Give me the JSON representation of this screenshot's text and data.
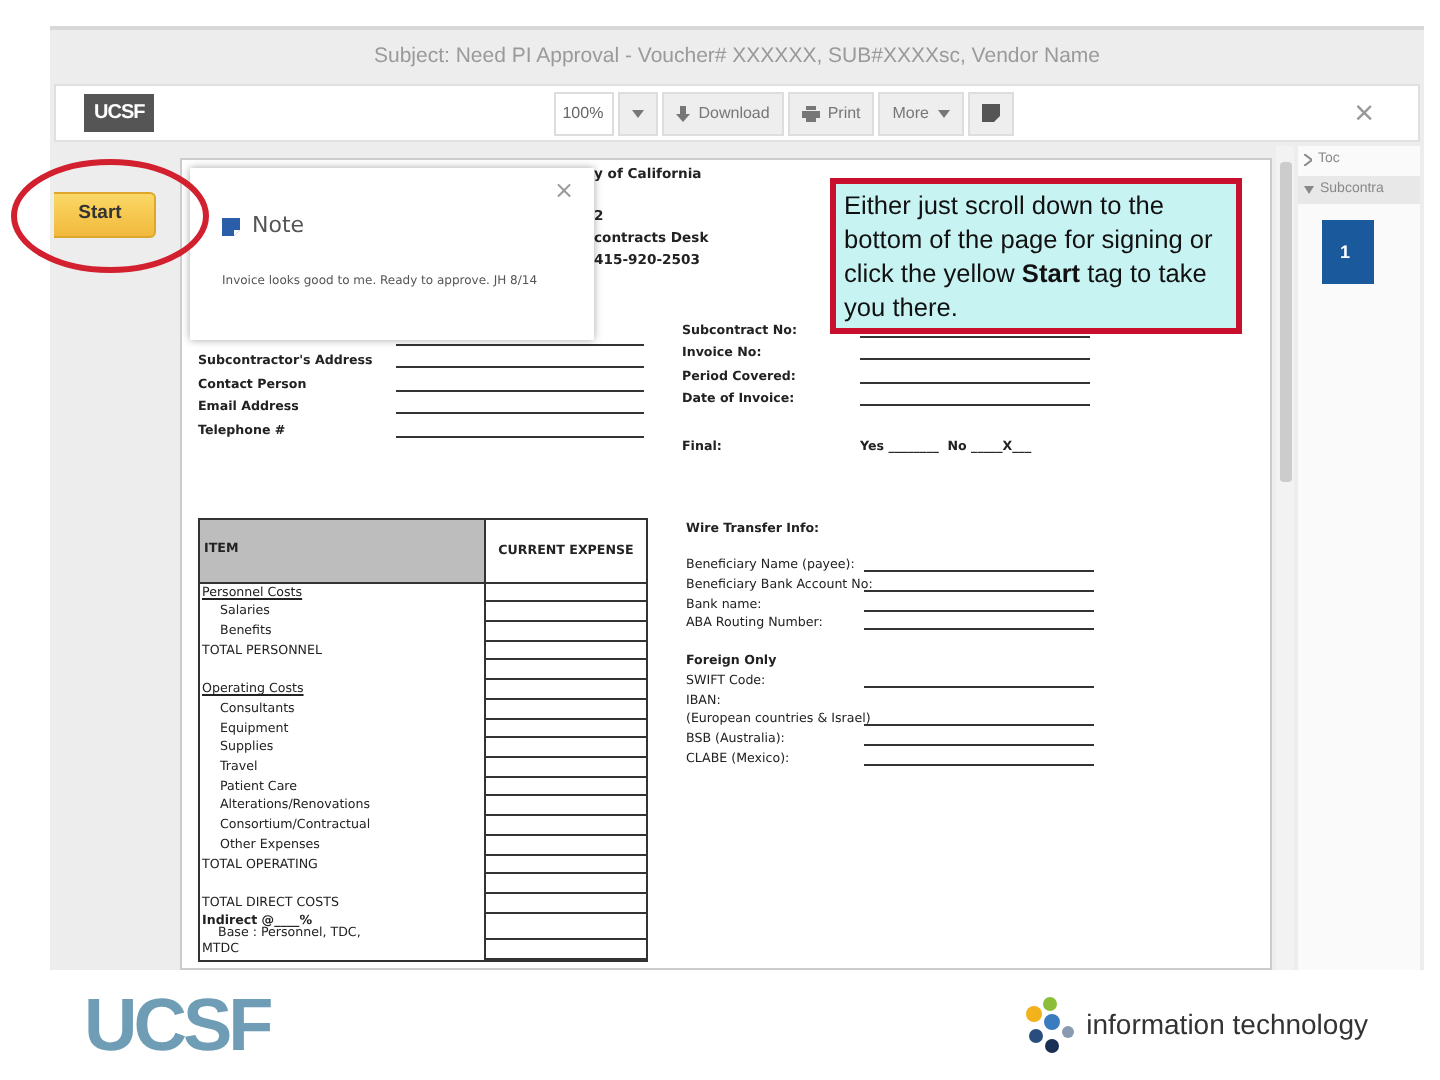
{
  "subject": "Subject: Need PI Approval - Voucher# XXXXXX, SUB#XXXXsc, Vendor Name",
  "toolbar": {
    "logo": "UCSF",
    "zoom": "100%",
    "buttons": [
      {
        "kind": "dropdown"
      },
      {
        "kind": "download",
        "label": "Download"
      },
      {
        "kind": "print",
        "label": "Print"
      },
      {
        "kind": "more",
        "label": "More"
      },
      {
        "kind": "note"
      }
    ],
    "close": "×"
  },
  "start_tag": "Start",
  "note": {
    "title": "Note",
    "text": "Invoice looks good to me. Ready to approve. JH 8/14",
    "close": "×"
  },
  "document": {
    "header_lines": [
      "y of California",
      "2",
      "contracts Desk",
      "415-920-2503"
    ],
    "left_fields": [
      "Subcontractor's Address",
      "Contact Person",
      "Email Address",
      "Telephone #"
    ],
    "right_fields": [
      "Subcontract No:",
      "Invoice No:",
      "Period Covered:",
      "Date of Invoice:"
    ],
    "final": {
      "label": "Final:",
      "value": "Yes ________  No _____X___"
    },
    "table": {
      "columns": [
        "ITEM",
        "CURRENT EXPENSE"
      ],
      "rows": [
        {
          "kind": "section",
          "label": "Personnel Costs"
        },
        {
          "kind": "item",
          "label": "Salaries"
        },
        {
          "kind": "item",
          "label": "Benefits"
        },
        {
          "kind": "total",
          "label": "TOTAL PERSONNEL"
        },
        {
          "kind": "spacer"
        },
        {
          "kind": "section",
          "label": "Operating Costs"
        },
        {
          "kind": "item",
          "label": "Consultants"
        },
        {
          "kind": "item",
          "label": "Equipment"
        },
        {
          "kind": "item",
          "label": "Supplies"
        },
        {
          "kind": "item",
          "label": "Travel"
        },
        {
          "kind": "item",
          "label": "Patient Care"
        },
        {
          "kind": "item",
          "label": "Alterations/Renovations"
        },
        {
          "kind": "item",
          "label": "Consortium/Contractual"
        },
        {
          "kind": "item",
          "label": "Other Expenses"
        },
        {
          "kind": "total",
          "label": "TOTAL OPERATING"
        },
        {
          "kind": "spacer"
        },
        {
          "kind": "total",
          "label": "TOTAL DIRECT COSTS"
        },
        {
          "kind": "indirect",
          "label": "Indirect @____%",
          "note": "Base : Personnel, TDC,"
        },
        {
          "kind": "total",
          "label": "MTDC"
        }
      ]
    },
    "wire": {
      "title": "Wire Transfer Info:",
      "fields": [
        {
          "label": "Beneficiary Name (payee):",
          "line": true
        },
        {
          "label": "Beneficiary Bank Account No:",
          "line": true
        },
        {
          "label": "Bank name:",
          "line": true
        },
        {
          "label": "ABA Routing Number:",
          "line": true
        }
      ],
      "foreign_title": "Foreign Only",
      "foreign_fields": [
        {
          "label": "SWIFT Code:",
          "line": true
        },
        {
          "label": "IBAN:",
          "line": false
        },
        {
          "label": "(European countries & Israel)",
          "line": true
        },
        {
          "label": "BSB (Australia):",
          "line": true
        },
        {
          "label": "CLABE (Mexico):",
          "line": true
        }
      ]
    }
  },
  "side_panel": {
    "items": [
      {
        "label": "Toc",
        "expanded": false
      },
      {
        "label": "Subcontra",
        "expanded": true
      }
    ],
    "page": "1"
  },
  "callout": "Either just scroll down to the bottom of the page for signing or click the yellow **Start** tag to take you there.",
  "footer": {
    "logo": "UCSF",
    "it_label": "information technology"
  }
}
